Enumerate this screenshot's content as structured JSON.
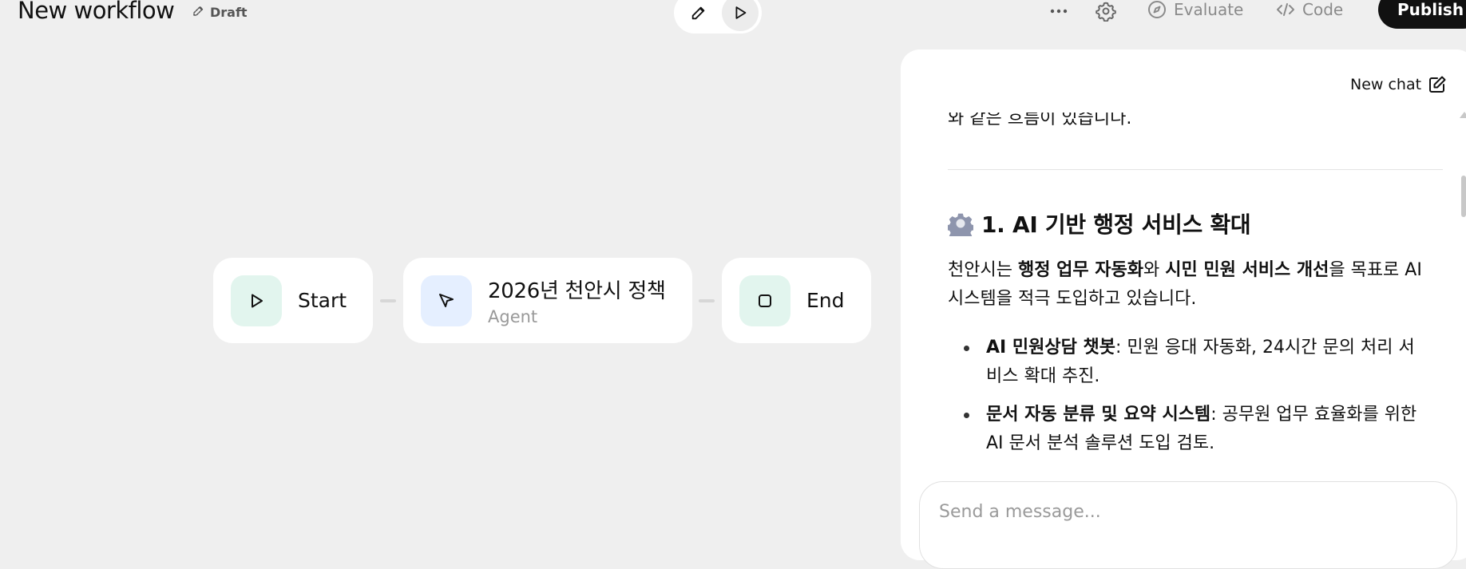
{
  "header": {
    "title": "New workflow",
    "draft_label": "Draft",
    "actions": {
      "evaluate_label": "Evaluate",
      "code_label": "Code",
      "publish_label": "Publish"
    }
  },
  "workflow": {
    "nodes": [
      {
        "label": "Start",
        "icon": "play-icon"
      },
      {
        "label": "2026년 천안시 정책",
        "sublabel": "Agent",
        "icon": "cursor-icon"
      },
      {
        "label": "End",
        "icon": "stop-square-icon"
      }
    ]
  },
  "chat": {
    "new_chat_label": "New chat",
    "cut_off_line": "와 같은 흐름이 있습니다.",
    "section_heading": "1. AI 기반 행정 서비스 확대",
    "paragraph": {
      "p1": "천안시는 ",
      "b1": "행정 업무 자동화",
      "p2": "와 ",
      "b2": "시민 민원 서비스 개선",
      "p3": "을 목표로 AI 시스템을 적극 도입하고 있습니다."
    },
    "bullets": [
      {
        "bold": "AI 민원상담 챗봇",
        "text": ": 민원 응대 자동화, 24시간 문의 처리 서비스 확대 추진."
      },
      {
        "bold": "문서 자동 분류 및 요약 시스템",
        "text": ": 공무원 업무 효율화를 위한 AI 문서 분석 솔루션 도입 검토."
      }
    ],
    "input_placeholder": "Send a message..."
  },
  "colors": {
    "canvas_bg": "#efefef",
    "publish_bg": "#111111",
    "start_end_icon_bg": "#e2f5ee",
    "agent_icon_bg": "#e5efff"
  }
}
